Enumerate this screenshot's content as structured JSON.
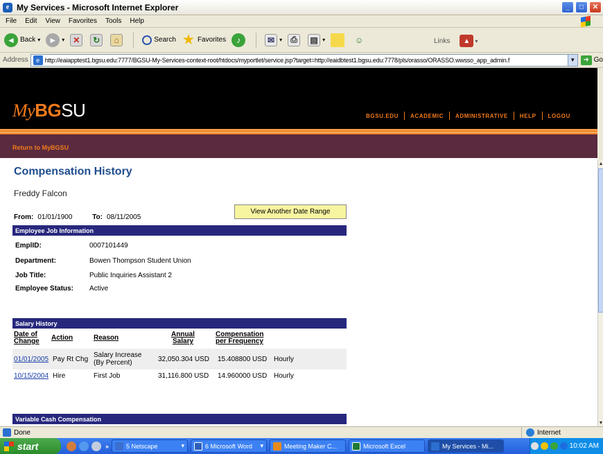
{
  "window": {
    "title": "My Services - Microsoft Internet Explorer"
  },
  "menu": [
    "File",
    "Edit",
    "View",
    "Favorites",
    "Tools",
    "Help"
  ],
  "toolbar": {
    "back": "Back",
    "search": "Search",
    "favorites": "Favorites",
    "links": "Links"
  },
  "address": {
    "label": "Address",
    "url": "http://eaiapptest1.bgsu.edu:7777/BGSU-My-Services-context-root/htdocs/myportlet/service.jsp?target=http://eaidbtest1.bgsu.edu:7778/pls/orasso/ORASSO.wwsso_app_admin.f",
    "go": "Go"
  },
  "site": {
    "logo_my": "My",
    "logo_bg": "BG",
    "logo_su": "SU",
    "nav": [
      "BGSU.EDU",
      "ACADEMIC",
      "ADMINISTRATIVE",
      "HELP",
      "LOGOU"
    ],
    "return_link": "Return to MyBGSU"
  },
  "page": {
    "title": "Compensation History",
    "employee_name": "Freddy Falcon",
    "from_label": "From:",
    "from_value": "01/01/1900",
    "to_label": "To:",
    "to_value": "08/11/2005",
    "range_button": "View Another Date Range"
  },
  "job_info": {
    "heading": "Employee Job Information",
    "rows": [
      {
        "key": "EmplID:",
        "value": "0007101449"
      },
      {
        "key": "Department:",
        "value": "Bowen Thompson Student Union"
      },
      {
        "key": "Job Title:",
        "value": "Public Inquiries Assistant 2"
      },
      {
        "key": "Employee Status:",
        "value": "Active"
      }
    ]
  },
  "salary_history": {
    "heading": "Salary History",
    "columns": {
      "date": [
        "Date of",
        "Change"
      ],
      "action": [
        "Action"
      ],
      "reason": [
        "Reason"
      ],
      "annual": [
        "Annual",
        "Salary"
      ],
      "comp": [
        "Compensation",
        "per Frequency"
      ]
    },
    "rows": [
      {
        "date": "01/01/2005",
        "action": "Pay Rt Chg",
        "reason": [
          "Salary Increase",
          "(By Percent)"
        ],
        "annual": "32,050.304 USD",
        "comp": "15.408800 USD",
        "freq": "Hourly"
      },
      {
        "date": "10/15/2004",
        "action": "Hire",
        "reason": [
          "First Job"
        ],
        "annual": "31,116.800 USD",
        "comp": "14.960000 USD",
        "freq": "Hourly"
      }
    ]
  },
  "variable_cash": {
    "heading": "Variable Cash Compensation"
  },
  "status": {
    "text": "Done",
    "zone": "Internet"
  },
  "taskbar": {
    "start": "start",
    "tasks": [
      {
        "label": "5 Netscape",
        "color": "#3a6fd0"
      },
      {
        "label": "6 Microsoft Word",
        "color": "#2d5fb8"
      },
      {
        "label": "Meeting Maker C...",
        "color": "#e88a1c"
      },
      {
        "label": "Microsoft Excel",
        "color": "#1f7a35"
      },
      {
        "label": "My Services - Mi...",
        "color": "#2b6fd0"
      }
    ],
    "clock": "10:02 AM"
  },
  "colors": {
    "accent_orange": "#f27a1b",
    "section_navy": "#27287d",
    "title_blue": "#1f4d8f",
    "purple_bar": "#5a2a3f"
  }
}
